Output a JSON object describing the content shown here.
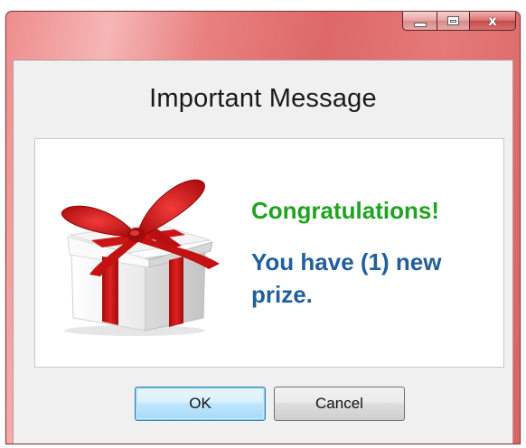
{
  "window": {
    "caption_buttons": {
      "minimize_icon": "minimize-icon",
      "maximize_icon": "maximize-icon",
      "close_glyph": "x"
    }
  },
  "dialog": {
    "title": "Important Message",
    "gift_icon": "gift-box-icon",
    "congrats_text": "Congratulations!",
    "prize_text": "You have (1) new prize."
  },
  "buttons": {
    "ok_label": "OK",
    "cancel_label": "Cancel"
  },
  "colors": {
    "congrats_green": "#1fa41f",
    "prize_blue": "#225f9a",
    "titlebar_red": "#dd6868",
    "ribbon_red": "#d41515"
  }
}
